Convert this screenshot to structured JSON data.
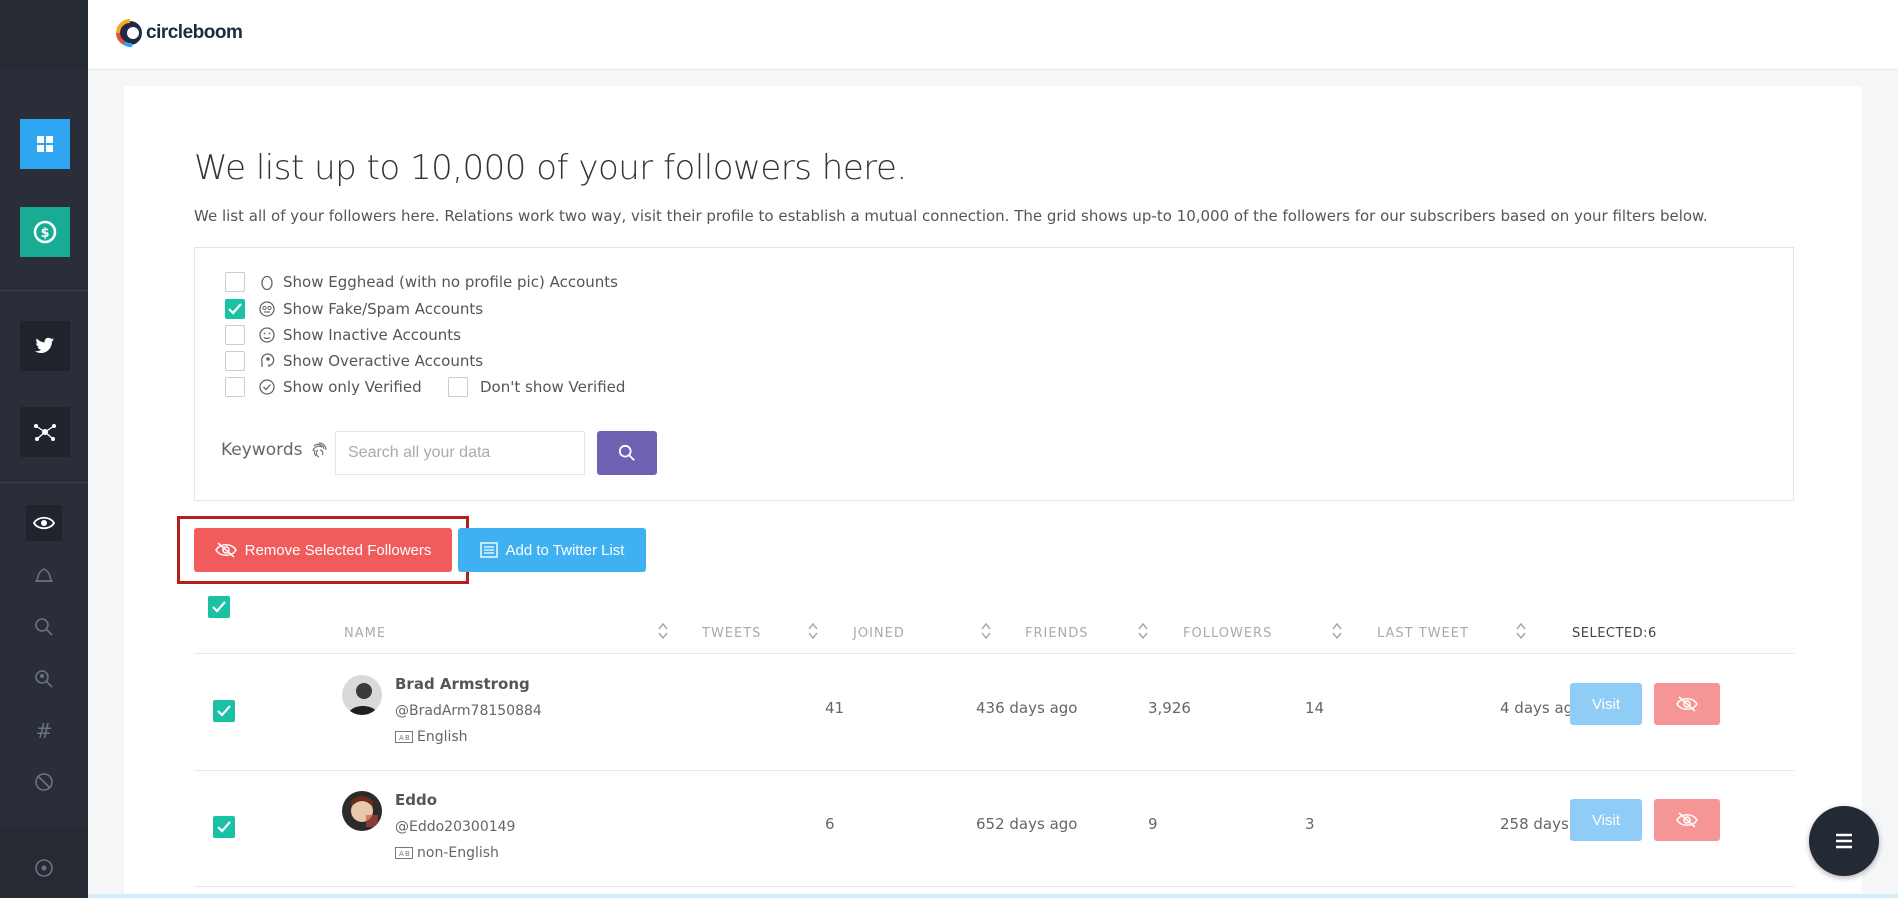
{
  "app": {
    "logo_text": "circleboom"
  },
  "sidebar": {
    "items": [
      {
        "name": "dashboard",
        "icon": "grid-icon"
      },
      {
        "name": "subscription",
        "icon": "dollar-icon"
      },
      {
        "name": "twitter",
        "icon": "twitter-icon"
      },
      {
        "name": "network",
        "icon": "network-icon"
      },
      {
        "name": "eye",
        "icon": "eye-icon"
      },
      {
        "name": "bell",
        "icon": "bell-icon"
      },
      {
        "name": "search",
        "icon": "search-icon"
      },
      {
        "name": "find-user",
        "icon": "search-user-icon"
      },
      {
        "name": "hashtag",
        "icon": "hashtag-icon"
      },
      {
        "name": "block",
        "icon": "block-icon"
      },
      {
        "name": "settings",
        "icon": "circle-icon"
      }
    ]
  },
  "page": {
    "title": "We list up to 10,000 of your followers here.",
    "subtitle": "We list all of your followers here. Relations work two way, visit their profile to establish a mutual connection. The grid shows up-to 10,000 of the followers for our subscribers based on your filters below."
  },
  "filters": {
    "items": [
      {
        "label": "Show Egghead (with no profile pic) Accounts",
        "checked": false,
        "icon": "egg-icon"
      },
      {
        "label": "Show Fake/Spam Accounts",
        "checked": true,
        "icon": "fake-face-icon"
      },
      {
        "label": "Show Inactive Accounts",
        "checked": false,
        "icon": "sleepy-face-icon"
      },
      {
        "label": "Show Overactive Accounts",
        "checked": false,
        "icon": "speech-head-icon"
      },
      {
        "label": "Show only Verified",
        "checked": false,
        "icon": "verified-icon"
      }
    ],
    "dont_show_verified": {
      "label": "Don't show Verified",
      "checked": false
    },
    "keywords_label": "Keywords",
    "search_placeholder": "Search all your data"
  },
  "actions": {
    "remove_label": "Remove Selected Followers",
    "add_list_label": "Add to Twitter List"
  },
  "table": {
    "columns": [
      "NAME",
      "TWEETS",
      "JOINED",
      "FRIENDS",
      "FOLLOWERS",
      "LAST TWEET"
    ],
    "selected_label": "SELECTED:6",
    "rows": [
      {
        "name": "Brad Armstrong",
        "handle": "@BradArm78150884",
        "language": "English",
        "tweets": "41",
        "joined": "436 days ago",
        "friends": "3,926",
        "followers": "14",
        "last_tweet": "4 days ago",
        "visit": "Visit",
        "checked": true
      },
      {
        "name": "Eddo",
        "handle": "@Eddo20300149",
        "language": "non-English",
        "tweets": "6",
        "joined": "652 days ago",
        "friends": "9",
        "followers": "3",
        "last_tweet": "258 days ago",
        "visit": "Visit",
        "checked": true
      }
    ]
  },
  "colors": {
    "accent_teal": "#1ac1a3",
    "remove_red": "#f25b5b",
    "list_blue": "#3fb0f2",
    "search_purple": "#7161b3",
    "highlight": "#b21f1f"
  }
}
